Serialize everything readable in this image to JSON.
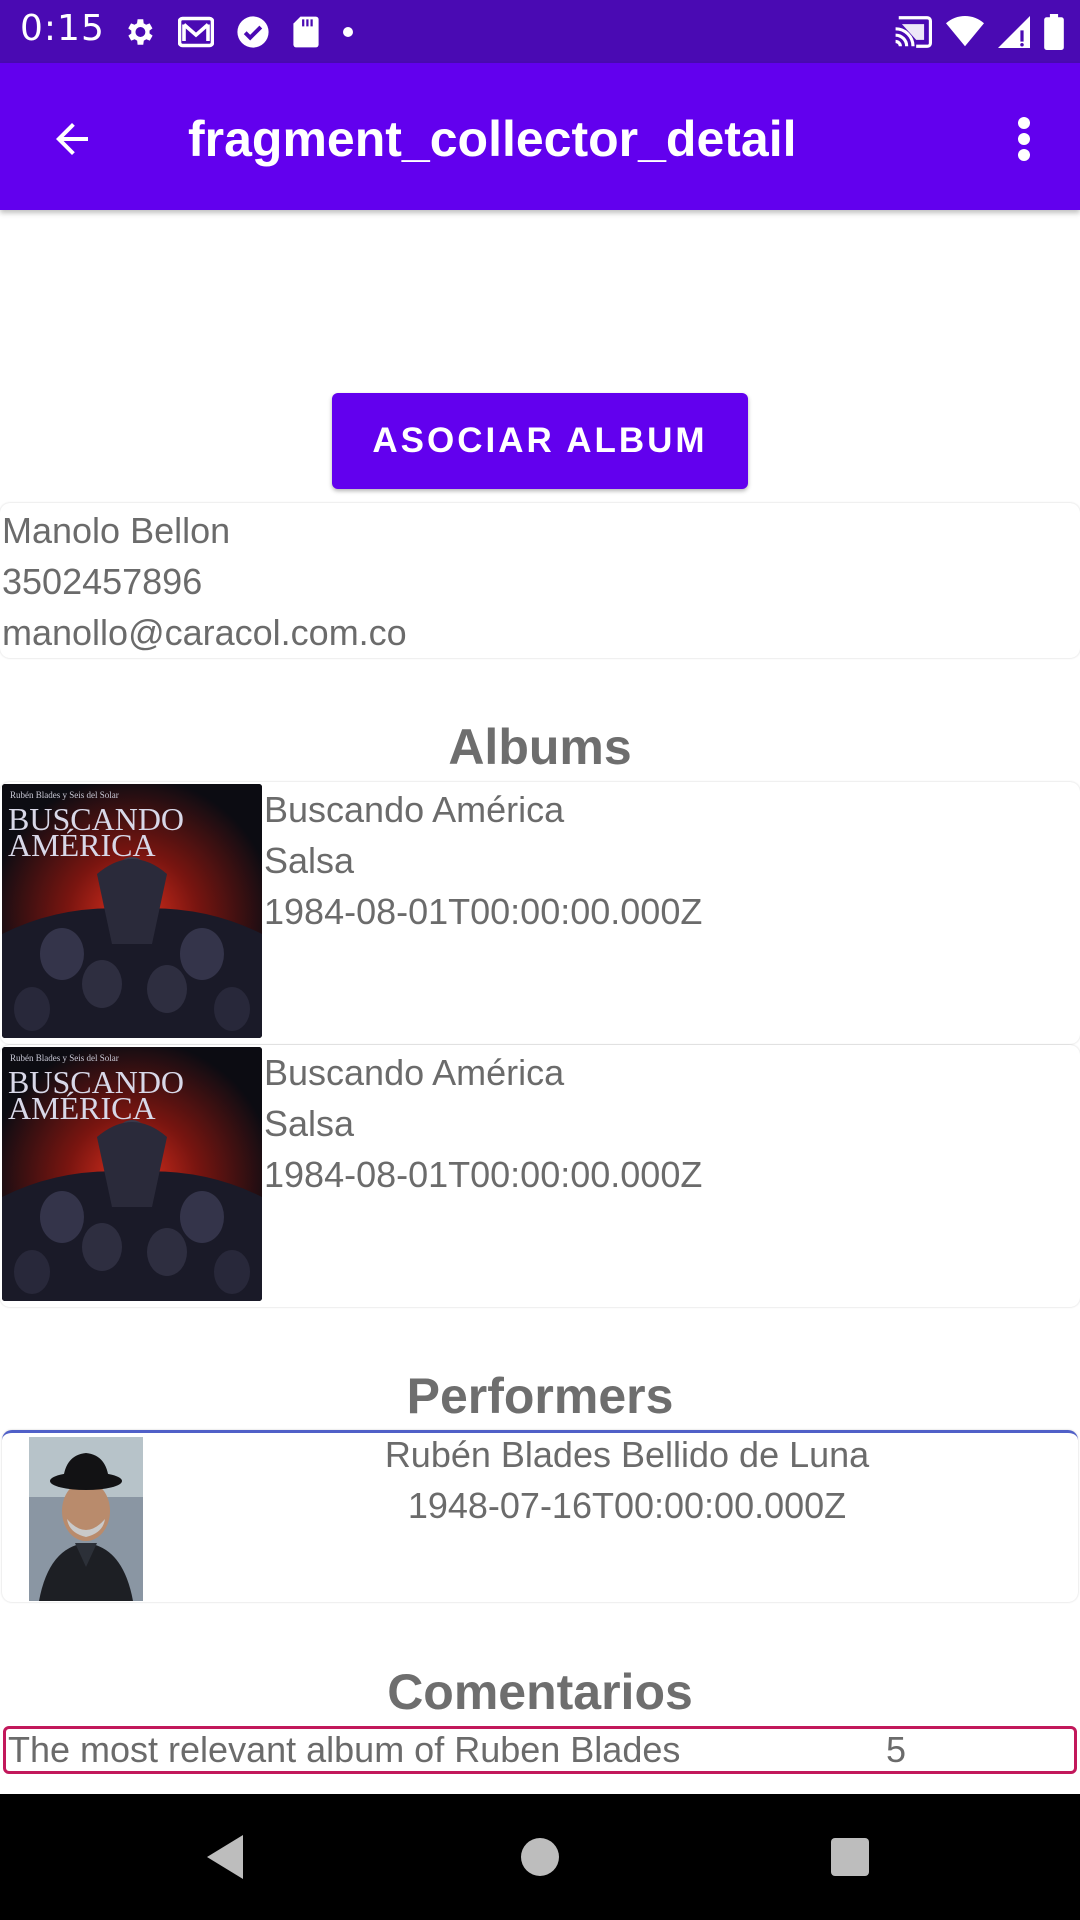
{
  "status_bar": {
    "time": "0:15",
    "left_icons": [
      "settings-icon",
      "gmail-icon",
      "check-circle-icon",
      "sd-card-icon",
      "dot-icon"
    ],
    "right_icons": [
      "cast-icon",
      "wifi-icon",
      "signal-icon",
      "battery-icon"
    ]
  },
  "app_bar": {
    "title": "fragment_collector_detail",
    "back_icon": "arrow-back-icon",
    "menu_icon": "more-vert-icon",
    "color": "#6200ee"
  },
  "actions": {
    "associate_album_label": "ASOCIAR ALBUM"
  },
  "collector": {
    "name": "Manolo Bellon",
    "phone": "3502457896",
    "email": "manollo@caracol.com.co"
  },
  "albums_section": {
    "title": "Albums",
    "items": [
      {
        "name": "Buscando América",
        "genre": "Salsa",
        "release_date": "1984-08-01T00:00:00.000Z",
        "cover_title_1": "BUSCANDO",
        "cover_title_2": "AMÉRICA",
        "cover_subtitle": "Rubén Blades y Seis del Solar"
      },
      {
        "name": "Buscando América",
        "genre": "Salsa",
        "release_date": "1984-08-01T00:00:00.000Z",
        "cover_title_1": "BUSCANDO",
        "cover_title_2": "AMÉRICA",
        "cover_subtitle": "Rubén Blades y Seis del Solar"
      }
    ]
  },
  "performers_section": {
    "title": "Performers",
    "items": [
      {
        "name": "Rubén Blades Bellido de Luna",
        "birth_date": "1948-07-16T00:00:00.000Z"
      }
    ]
  },
  "comments_section": {
    "title": "Comentarios",
    "items": [
      {
        "description": "The most relevant album of Ruben Blades",
        "rating": "5"
      }
    ]
  },
  "nav_bar": {
    "icons": [
      "nav-back-icon",
      "nav-home-icon",
      "nav-recents-icon"
    ]
  },
  "colors": {
    "status_bar": "#4a0ab3",
    "primary": "#6200ee",
    "performer_border": "#5060c8",
    "comment_border": "#c2185b"
  }
}
